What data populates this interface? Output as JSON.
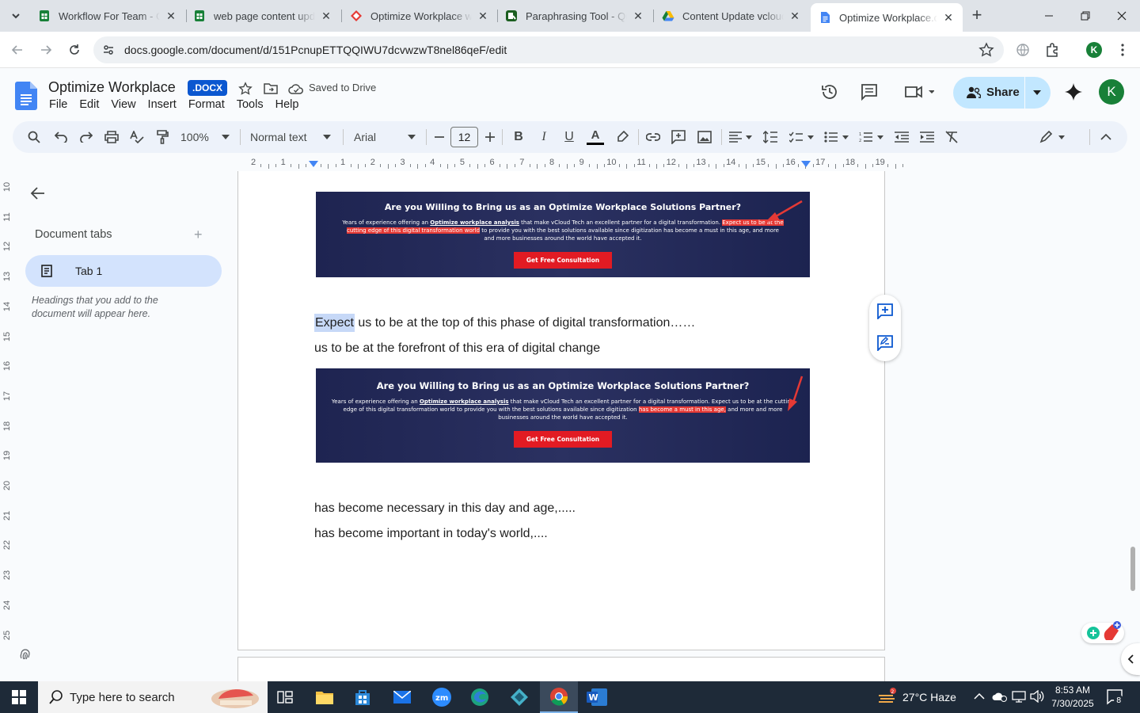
{
  "browser": {
    "tabs": [
      {
        "title": "Workflow For Team - Go",
        "icon": "sheets-icon"
      },
      {
        "title": "web page content upda",
        "icon": "sheets-icon"
      },
      {
        "title": "Optimize Workplace wit",
        "icon": "red-diamond-icon"
      },
      {
        "title": "Paraphrasing Tool - Qui",
        "icon": "quillbot-icon"
      },
      {
        "title": "Content Update vcloud",
        "icon": "drive-icon"
      },
      {
        "title": "Optimize Workplace.do",
        "icon": "docs-icon",
        "active": true
      }
    ],
    "url": "docs.google.com/document/d/151PcnupETTQQIWU7dcvwzwT8nel86qeF/edit",
    "profile_initial": "K"
  },
  "docs": {
    "title": "Optimize Workplace",
    "badge": ".DOCX",
    "saved_status": "Saved to Drive",
    "menu": [
      "File",
      "Edit",
      "View",
      "Insert",
      "Format",
      "Tools",
      "Help"
    ],
    "share_label": "Share",
    "avatar_initial": "K"
  },
  "format_toolbar": {
    "zoom": "100%",
    "style": "Normal text",
    "font": "Arial",
    "font_size": "12"
  },
  "ruler": {
    "h_numbers": [
      "2",
      "1",
      "",
      "1",
      "2",
      "3",
      "4",
      "5",
      "6",
      "7",
      "8",
      "9",
      "10",
      "11",
      "12",
      "13",
      "14",
      "15",
      "16",
      "17",
      "18",
      "19"
    ],
    "v_numbers": [
      "10",
      "11",
      "12",
      "13",
      "14",
      "15",
      "16",
      "17",
      "18",
      "19",
      "20",
      "21",
      "22",
      "23",
      "24",
      "25"
    ]
  },
  "sidebar": {
    "title": "Document tabs",
    "tab_label": "Tab 1",
    "hint": "Headings that you add to the document will appear here."
  },
  "document": {
    "banner1": {
      "heading": "Are you Willing to Bring us as an Optimize Workplace Solutions Partner?",
      "text_a": "Years of experience offering an ",
      "text_link": "Optimize workplace analysis",
      "text_b": " that make vCloud Tech an excellent partner for a digital transformation. ",
      "text_hl": "Expect us to be at the cutting edge of this digital transformation world",
      "text_c": " to provide you with the best solutions available since digitization has become a must in this age, and more and more businesses around the world have accepted it.",
      "cta": "Get Free Consultation"
    },
    "line1_selected": "Expect",
    "line1_rest": " us to be at the top of this phase of digital transformation……",
    "line2": "us to be at the forefront of this era of digital change",
    "banner2": {
      "heading": "Are you Willing to Bring us as an Optimize Workplace Solutions Partner?",
      "text_a": "Years of experience offering an ",
      "text_link": "Optimize workplace analysis",
      "text_b": " that make vCloud Tech an excellent partner for a digital transformation. Expect us to be at the cutting edge of this digital transformation world to provide you with the best solutions available since digitization ",
      "text_hl": "has become a must in this age,",
      "text_c": " and more and more businesses around the world have accepted it.",
      "cta": "Get Free Consultation"
    },
    "line3": "has become necessary in this day and age,.....",
    "line4": "has become important in today's world,...."
  },
  "taskbar": {
    "search_placeholder": "Type here to search",
    "temperature": "27°C",
    "weather": "Haze",
    "weather_badge": "2",
    "time": "8:53 AM",
    "date": "7/30/2025",
    "notification_count": "8"
  },
  "colors": {
    "accent": "#0b57d0",
    "share_bg": "#c2e7ff",
    "banner_bg": "#1e2451",
    "cta_red": "#e21b23"
  }
}
